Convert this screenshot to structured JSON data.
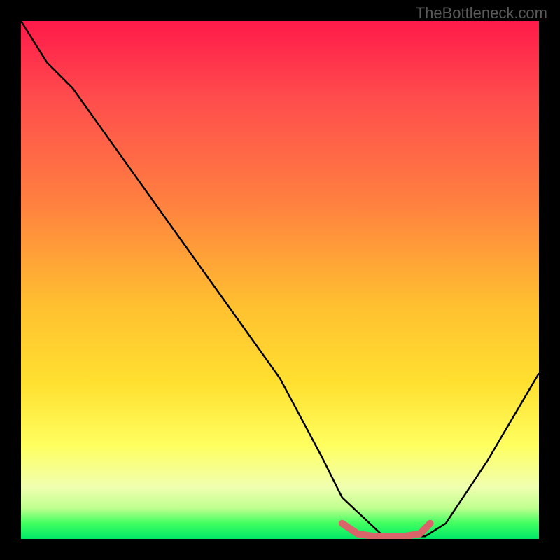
{
  "watermark": "TheBottleneck.com",
  "chart_data": {
    "type": "line",
    "title": "",
    "xlabel": "",
    "ylabel": "",
    "xlim": [
      0,
      100
    ],
    "ylim": [
      0,
      100
    ],
    "series": [
      {
        "name": "main-curve",
        "color": "#000000",
        "x": [
          0,
          5,
          10,
          20,
          30,
          40,
          50,
          58,
          62,
          70,
          78,
          82,
          90,
          100
        ],
        "y": [
          100,
          92,
          87,
          73,
          59,
          45,
          31,
          16,
          8,
          0.5,
          0.5,
          3,
          15,
          32
        ]
      },
      {
        "name": "bottom-marker",
        "color": "#d9646a",
        "x": [
          62,
          65,
          68,
          71,
          74,
          77,
          79
        ],
        "y": [
          3,
          1,
          0.5,
          0.5,
          0.5,
          1,
          3
        ]
      }
    ],
    "gradient_background": {
      "top": "#ff1a4a",
      "mid": "#ffe030",
      "bottom": "#00e868"
    }
  }
}
